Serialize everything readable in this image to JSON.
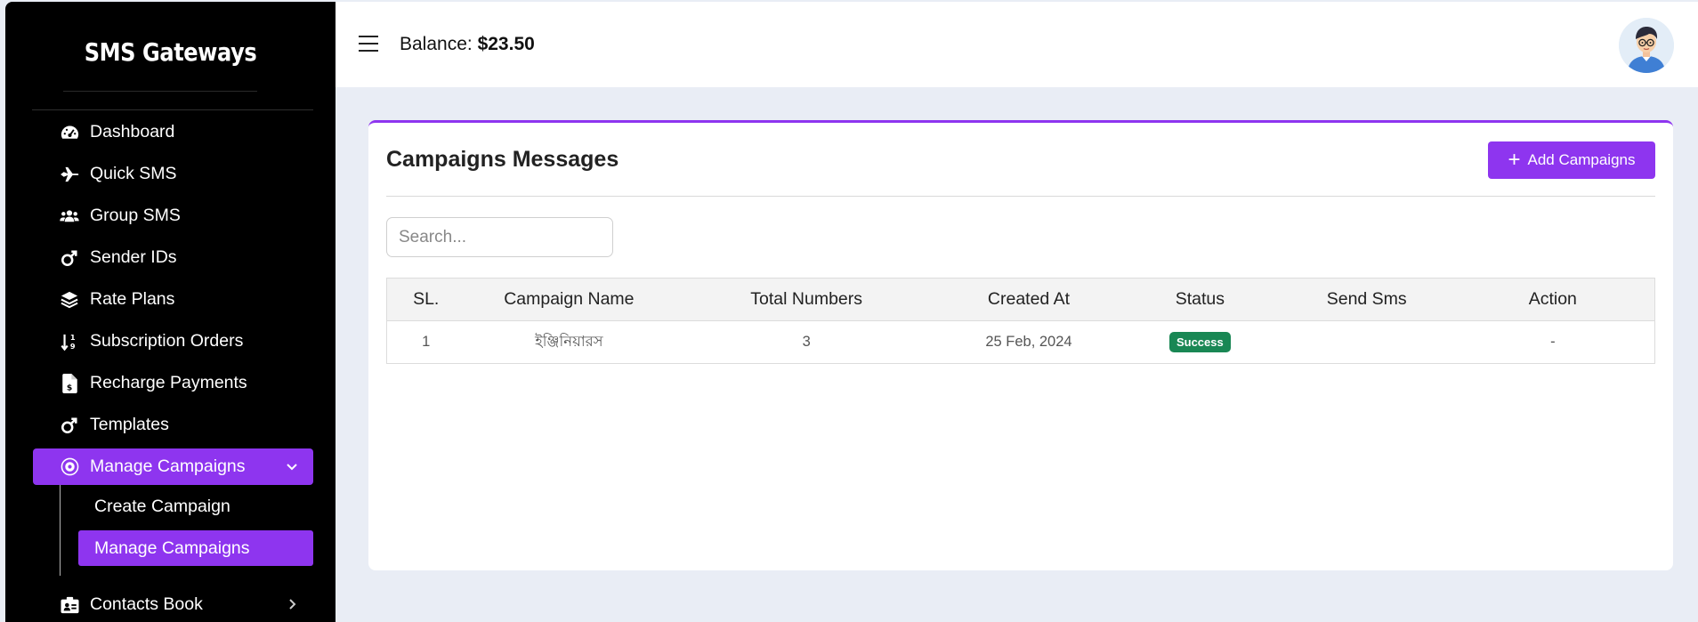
{
  "sidebar": {
    "brand": "SMS Gateways",
    "items": [
      {
        "label": "Dashboard",
        "icon": "gauge-icon"
      },
      {
        "label": "Quick SMS",
        "icon": "plane-icon"
      },
      {
        "label": "Group SMS",
        "icon": "users-icon"
      },
      {
        "label": "Sender IDs",
        "icon": "mars-icon"
      },
      {
        "label": "Rate Plans",
        "icon": "layers-icon"
      },
      {
        "label": "Subscription Orders",
        "icon": "sort-icon"
      },
      {
        "label": "Recharge Payments",
        "icon": "invoice-dollar-icon"
      },
      {
        "label": "Templates",
        "icon": "mars-icon"
      },
      {
        "label": "Manage Campaigns",
        "icon": "campaign-icon"
      }
    ],
    "submenu": [
      {
        "label": "Create Campaign"
      },
      {
        "label": "Manage Campaigns"
      }
    ],
    "contacts": {
      "label": "Contacts Book",
      "icon": "address-card-icon"
    }
  },
  "topbar": {
    "balance_label": "Balance:",
    "balance_value": "$23.50"
  },
  "card": {
    "title": "Campaigns Messages",
    "add_button": "Add Campaigns",
    "search_placeholder": "Search..."
  },
  "table": {
    "headers": [
      "SL.",
      "Campaign Name",
      "Total Numbers",
      "Created At",
      "Status",
      "Send Sms",
      "Action"
    ],
    "rows": [
      {
        "sl": "1",
        "name": "ইঞ্জিনিয়ারস",
        "total": "3",
        "created": "25 Feb, 2024",
        "status": "Success",
        "send": "",
        "action": "-"
      }
    ]
  },
  "colors": {
    "accent": "#8e35ef",
    "success": "#198754",
    "sidebar_bg": "#000000"
  }
}
